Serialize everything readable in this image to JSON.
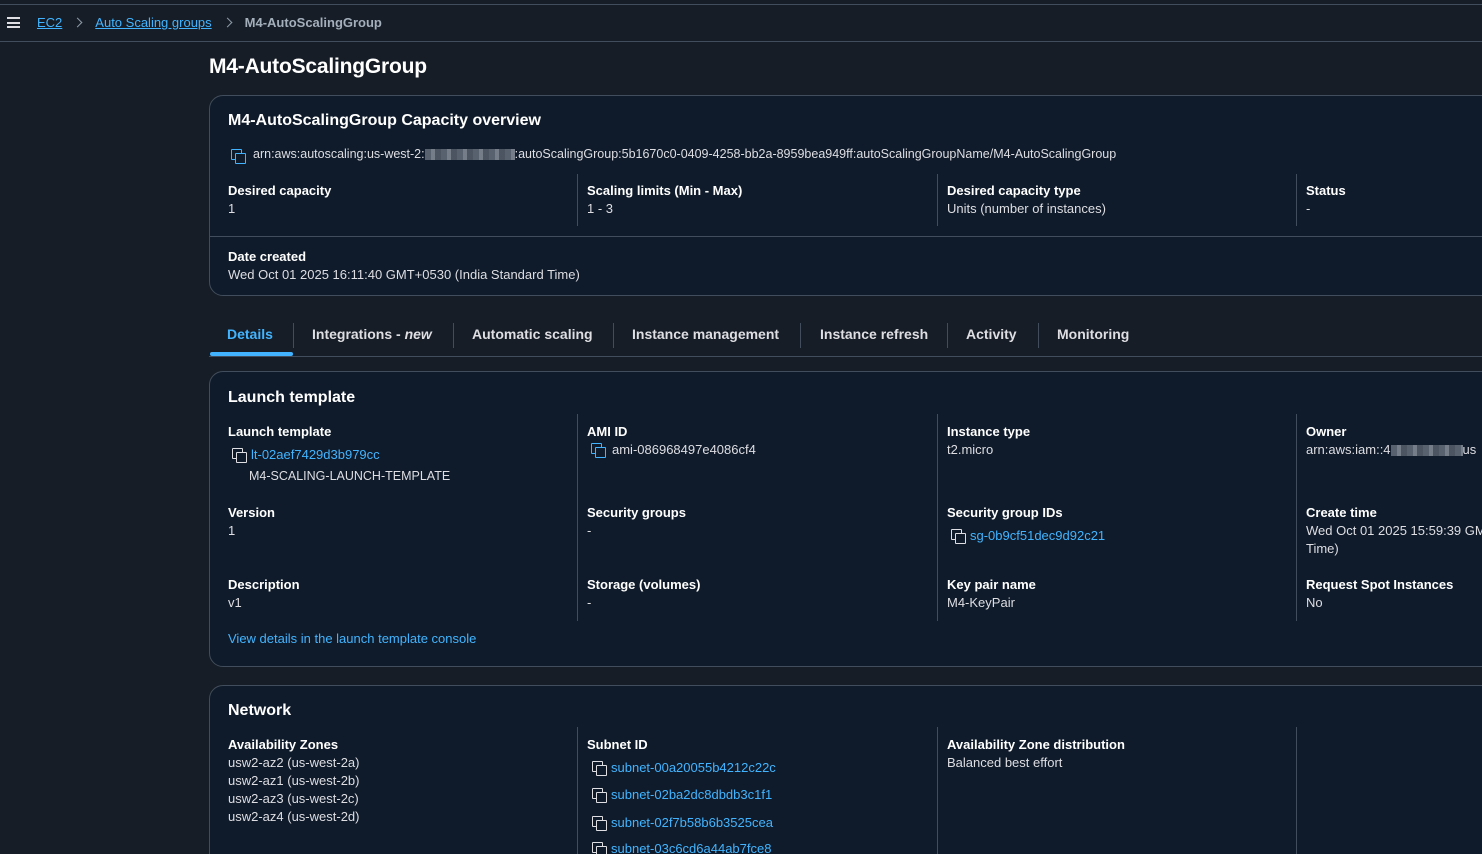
{
  "breadcrumb": {
    "items": [
      "EC2",
      "Auto Scaling groups"
    ],
    "current": "M4-AutoScalingGroup"
  },
  "page_title": "M4-AutoScalingGroup",
  "capacity": {
    "title": "M4-AutoScalingGroup Capacity overview",
    "arn_prefix": "arn:aws:autoscaling:us-west-2:",
    "arn_suffix": ":autoScalingGroup:5b1670c0-0409-4258-bb2a-8959bea949ff:autoScalingGroupName/M4-AutoScalingGroup",
    "desired_capacity_label": "Desired capacity",
    "desired_capacity": "1",
    "scaling_limits_label": "Scaling limits (Min - Max)",
    "scaling_limits": "1 - 3",
    "capacity_type_label": "Desired capacity type",
    "capacity_type": "Units (number of instances)",
    "status_label": "Status",
    "status": "-",
    "date_created_label": "Date created",
    "date_created": "Wed Oct 01 2025 16:11:40 GMT+0530 (India Standard Time)"
  },
  "tabs": [
    {
      "label": "Details"
    },
    {
      "label": "Integrations - ",
      "tag": "new"
    },
    {
      "label": "Automatic scaling"
    },
    {
      "label": "Instance management"
    },
    {
      "label": "Instance refresh"
    },
    {
      "label": "Activity"
    },
    {
      "label": "Monitoring"
    }
  ],
  "launch_template": {
    "title": "Launch template",
    "lt_label": "Launch template",
    "lt_id": "lt-02aef7429d3b979cc",
    "lt_name": "M4-SCALING-LAUNCH-TEMPLATE",
    "ami_label": "AMI ID",
    "ami_id": "ami-086968497e4086cf4",
    "instance_type_label": "Instance type",
    "instance_type": "t2.micro",
    "owner_label": "Owner",
    "owner_prefix": "arn:aws:iam::4",
    "owner_suffix": "us",
    "version_label": "Version",
    "version": "1",
    "security_groups_label": "Security groups",
    "security_groups": "-",
    "sg_ids_label": "Security group IDs",
    "sg_id": "sg-0b9cf51dec9d92c21",
    "create_time_label": "Create time",
    "create_time_line1": "Wed Oct 01 2025 15:59:39 GM",
    "create_time_line2": "Time)",
    "description_label": "Description",
    "description": "v1",
    "storage_label": "Storage (volumes)",
    "storage": "-",
    "key_pair_label": "Key pair name",
    "key_pair": "M4-KeyPair",
    "spot_label": "Request Spot Instances",
    "spot": "No",
    "console_link": "View details in the launch template console"
  },
  "network": {
    "title": "Network",
    "az_label": "Availability Zones",
    "azs": [
      "usw2-az2 (us-west-2a)",
      "usw2-az1 (us-west-2b)",
      "usw2-az3 (us-west-2c)",
      "usw2-az4 (us-west-2d)"
    ],
    "subnet_label": "Subnet ID",
    "subnets": [
      "subnet-00a20055b4212c22c",
      "subnet-02ba2dc8dbdb3c1f1",
      "subnet-02f7b58b6b3525cea",
      "subnet-03c6cd6a44ab7fce8"
    ],
    "az_dist_label": "Availability Zone distribution",
    "az_dist": "Balanced best effort"
  },
  "colors": {
    "background": "#161d26",
    "card": "#0f1b2a",
    "link": "#42b4ff",
    "border": "#414d5c"
  },
  "icons": [
    "menu-icon",
    "chevron-right-icon",
    "copy-icon"
  ]
}
